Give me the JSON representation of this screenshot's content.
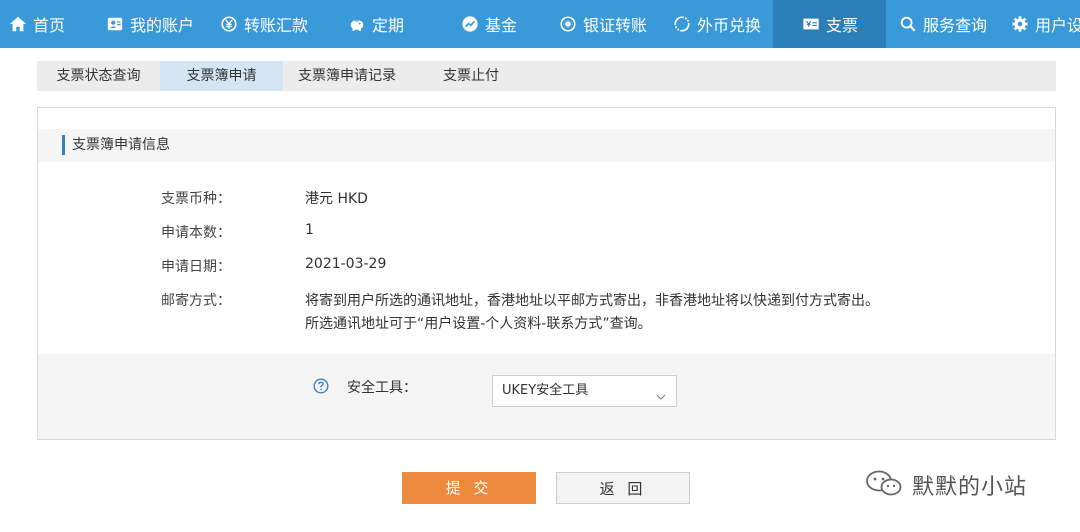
{
  "nav": {
    "items": [
      {
        "label": "首页",
        "icon": "home-icon"
      },
      {
        "label": "我的账户",
        "icon": "account-card-icon"
      },
      {
        "label": "转账汇款",
        "icon": "yen-circle-icon"
      },
      {
        "label": "定期",
        "icon": "piggy-bank-icon"
      },
      {
        "label": "基金",
        "icon": "chart-icon"
      },
      {
        "label": "银证转账",
        "icon": "exchange-circle-icon"
      },
      {
        "label": "外币兑换",
        "icon": "refresh-icon"
      },
      {
        "label": "支票",
        "icon": "cheque-icon"
      },
      {
        "label": "服务查询",
        "icon": "search-icon"
      },
      {
        "label": "用户设",
        "icon": "gear-icon"
      }
    ],
    "active": "支票",
    "colors": {
      "bar": "#3a9ad9",
      "active": "#2b7fb8"
    }
  },
  "subtabs": {
    "items": [
      {
        "label": "支票状态查询"
      },
      {
        "label": "支票簿申请"
      },
      {
        "label": "支票簿申请记录"
      },
      {
        "label": "支票止付"
      }
    ],
    "active": "支票簿申请"
  },
  "section": {
    "title": "支票簿申请信息"
  },
  "fields": {
    "currency": {
      "label": "支票币种：",
      "value": "港元 HKD"
    },
    "quantity": {
      "label": "申请本数：",
      "value": "1"
    },
    "date": {
      "label": "申请日期：",
      "value": "2021-03-29"
    },
    "delivery": {
      "label": "邮寄方式：",
      "line1": "将寄到用户所选的通讯地址，香港地址以平邮方式寄出，非香港地址将以快递到付方式寄出。",
      "line2": "所选通讯地址可于“用户设置-个人资料-联系方式”查询。"
    }
  },
  "security": {
    "label": "安全工具：",
    "selected": "UKEY安全工具",
    "help_icon": "help-circle-icon"
  },
  "buttons": {
    "submit": "提 交",
    "back": "返 回",
    "submit_color": "#ec8a3e"
  },
  "watermark": {
    "text": "默默的小站",
    "icon": "wechat-icon"
  }
}
